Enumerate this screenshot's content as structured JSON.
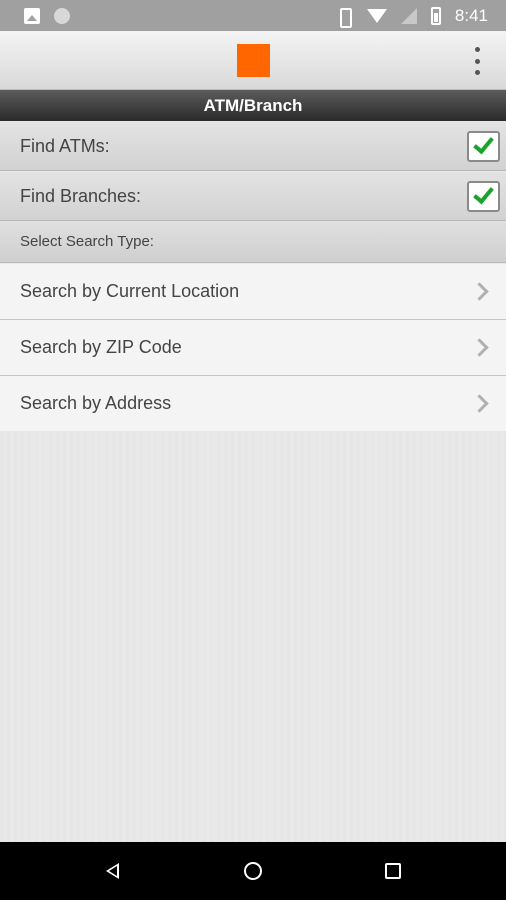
{
  "status_bar": {
    "time": "8:41",
    "icons_left": [
      "image-icon",
      "circle-icon"
    ],
    "icons_right": [
      "vibrate-icon",
      "wifi-icon",
      "signal-icon",
      "battery-icon"
    ]
  },
  "header": {
    "logo": "brand-logo",
    "logo_color": "#ff6600",
    "menu_icon": "overflow-menu-icon"
  },
  "title": "ATM/Branch",
  "toggles": [
    {
      "label": "Find ATMs:",
      "checked": true
    },
    {
      "label": "Find Branches:",
      "checked": true
    }
  ],
  "section_header": "Select Search Type:",
  "search_options": [
    {
      "label": "Search by Current Location",
      "icon": "chevron-right-icon"
    },
    {
      "label": "Search by ZIP Code",
      "icon": "chevron-right-icon"
    },
    {
      "label": "Search by Address",
      "icon": "chevron-right-icon"
    }
  ],
  "nav_bar": {
    "buttons": [
      "back-icon",
      "home-icon",
      "recents-icon"
    ]
  },
  "colors": {
    "check": "#1aa32a",
    "title_bar": "#2a2a2a",
    "accent": "#ff6600"
  }
}
